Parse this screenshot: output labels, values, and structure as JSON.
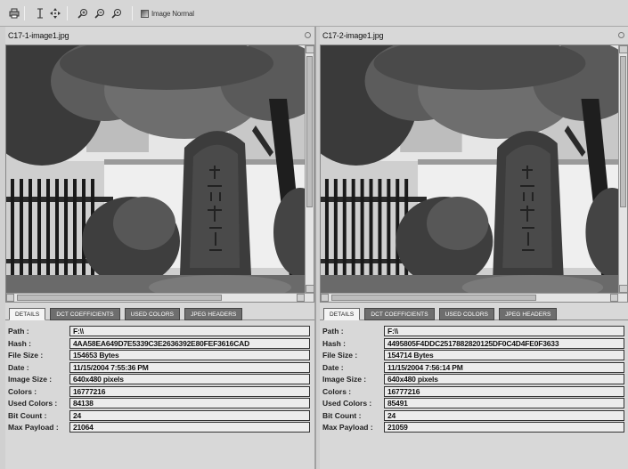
{
  "toolbar": {
    "buttons": [
      {
        "name": "print-icon"
      },
      {
        "name": "fit-icon"
      },
      {
        "name": "move-icon"
      },
      {
        "name": "zoom-in-icon"
      },
      {
        "name": "zoom-out-icon"
      },
      {
        "name": "zoom-reset-icon"
      }
    ],
    "image_mode_label": "Image Normal"
  },
  "tabs": [
    "DETAILS",
    "DCT COEFFICIENTS",
    "USED COLORS",
    "JPEG HEADERS"
  ],
  "left": {
    "title": "C17-1-image1.jpg",
    "details": [
      {
        "label": "Path :",
        "value": "F:\\\\"
      },
      {
        "label": "Hash :",
        "value": "4AA58EA649D7E5339C3E2636392E80FEF3616CAD"
      },
      {
        "label": "File Size :",
        "value": "154653 Bytes"
      },
      {
        "label": "Date :",
        "value": "11/15/2004 7:55:36 PM"
      },
      {
        "label": "Image Size :",
        "value": "640x480 pixels"
      },
      {
        "label": "Colors :",
        "value": "16777216"
      },
      {
        "label": "Used Colors :",
        "value": "84138"
      },
      {
        "label": "Bit Count :",
        "value": "24"
      },
      {
        "label": "Max Payload :",
        "value": "21064"
      }
    ]
  },
  "right": {
    "title": "C17-2-image1.jpg",
    "details": [
      {
        "label": "Path :",
        "value": "F:\\\\"
      },
      {
        "label": "Hash :",
        "value": "4495805F4DDC2517882820125DF0C4D4FE0F3633"
      },
      {
        "label": "File Size :",
        "value": "154714 Bytes"
      },
      {
        "label": "Date :",
        "value": "11/15/2004 7:56:14 PM"
      },
      {
        "label": "Image Size :",
        "value": "640x480 pixels"
      },
      {
        "label": "Colors :",
        "value": "16777216"
      },
      {
        "label": "Used Colors :",
        "value": "85491"
      },
      {
        "label": "Bit Count :",
        "value": "24"
      },
      {
        "label": "Max Payload :",
        "value": "21059"
      }
    ]
  }
}
